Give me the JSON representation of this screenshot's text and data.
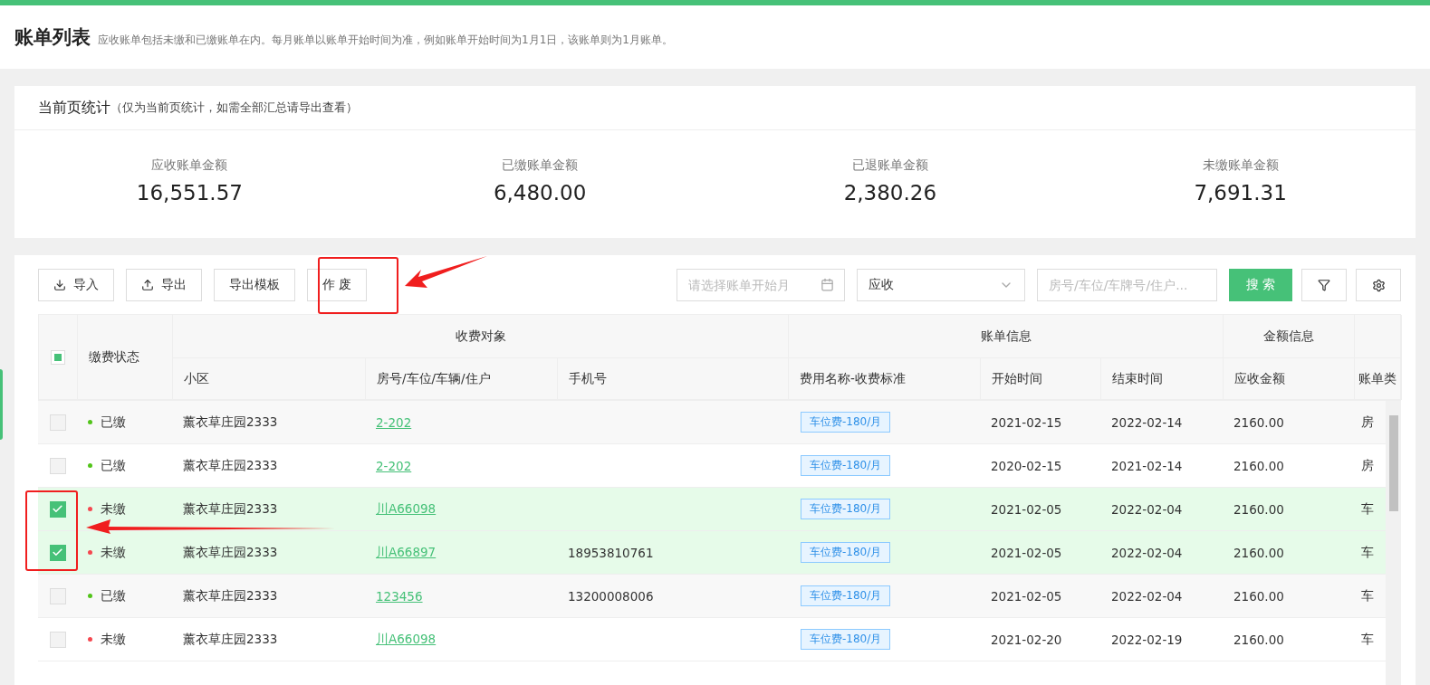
{
  "page": {
    "title": "账单列表",
    "description": "应收账单包括未缴和已缴账单在内。每月账单以账单开始时间为准，例如账单开始时间为1月1日，该账单则为1月账单。"
  },
  "stats": {
    "title": "当前页统计",
    "note": "（仅为当前页统计，如需全部汇总请导出查看）",
    "items": [
      {
        "label": "应收账单金额",
        "value": "16,551.57"
      },
      {
        "label": "已缴账单金额",
        "value": "6,480.00"
      },
      {
        "label": "已退账单金额",
        "value": "2,380.26"
      },
      {
        "label": "未缴账单金额",
        "value": "7,691.31"
      }
    ]
  },
  "toolbar": {
    "buttons": [
      {
        "kind": "import",
        "label": "导入"
      },
      {
        "kind": "export",
        "label": "导出"
      },
      {
        "kind": "plain",
        "label": "导出模板"
      },
      {
        "kind": "plain",
        "label": "作 废"
      }
    ],
    "month_field": {
      "placeholder": "请选择账单开始月"
    },
    "type_select": {
      "value": "应收"
    },
    "search_field": {
      "placeholder": "房号/车位/车牌号/住户..."
    },
    "search_button": "搜 索"
  },
  "table": {
    "select_all": {
      "indeterminate": true
    },
    "status_header": "缴费状态",
    "groups": [
      {
        "label": "收费对象"
      },
      {
        "label": "账单信息"
      },
      {
        "label": "金额信息"
      }
    ],
    "columns": [
      "小区",
      "房号/车位/车辆/住户",
      "手机号",
      "费用名称-收费标准",
      "开始时间",
      "结束时间",
      "应收金额",
      "账单类"
    ],
    "rows": [
      {
        "selected": false,
        "status": "已缴",
        "color": "#52c41a",
        "community": "薰衣草庄园2333",
        "unit": "2-202",
        "phone": "",
        "fee": "车位费-180/月",
        "start": "2021-02-15",
        "end": "2022-02-14",
        "amount": "2160.00",
        "type": "房"
      },
      {
        "selected": false,
        "status": "已缴",
        "color": "#52c41a",
        "community": "薰衣草庄园2333",
        "unit": "2-202",
        "phone": "",
        "fee": "车位费-180/月",
        "start": "2020-02-15",
        "end": "2021-02-14",
        "amount": "2160.00",
        "type": "房"
      },
      {
        "selected": true,
        "status": "未缴",
        "color": "#f5474f",
        "community": "薰衣草庄园2333",
        "unit": "川A66098",
        "phone": "",
        "fee": "车位费-180/月",
        "start": "2021-02-05",
        "end": "2022-02-04",
        "amount": "2160.00",
        "type": "车"
      },
      {
        "selected": true,
        "status": "未缴",
        "color": "#f5474f",
        "community": "薰衣草庄园2333",
        "unit": "川A66897",
        "phone": "18953810761",
        "fee": "车位费-180/月",
        "start": "2021-02-05",
        "end": "2022-02-04",
        "amount": "2160.00",
        "type": "车"
      },
      {
        "selected": false,
        "status": "已缴",
        "color": "#52c41a",
        "community": "薰衣草庄园2333",
        "unit": "123456",
        "phone": "13200008006",
        "fee": "车位费-180/月",
        "start": "2021-02-05",
        "end": "2022-02-04",
        "amount": "2160.00",
        "type": "车"
      },
      {
        "selected": false,
        "status": "未缴",
        "color": "#f5474f",
        "community": "薰衣草庄园2333",
        "unit": "川A66098",
        "phone": "",
        "fee": "车位费-180/月",
        "start": "2021-02-20",
        "end": "2022-02-19",
        "amount": "2160.00",
        "type": "车"
      }
    ]
  }
}
